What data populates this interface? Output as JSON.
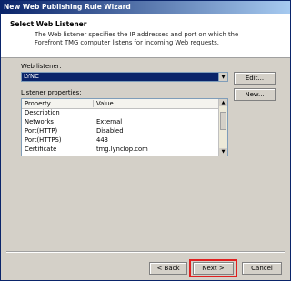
{
  "window": {
    "title": "New Web Publishing Rule Wizard"
  },
  "header": {
    "title": "Select Web Listener",
    "description": "The Web listener specifies the IP addresses and port on which the Forefront TMG computer listens for incoming Web requests."
  },
  "listener": {
    "label": "Web listener:",
    "selected": "LYNC",
    "edit_label": "Edit...",
    "new_label": "New..."
  },
  "properties": {
    "label": "Listener properties:",
    "columns": [
      "Property",
      "Value"
    ],
    "rows": [
      {
        "property": "Description",
        "value": ""
      },
      {
        "property": "Networks",
        "value": "External"
      },
      {
        "property": "Port(HTTP)",
        "value": "Disabled"
      },
      {
        "property": "Port(HTTPS)",
        "value": "443"
      },
      {
        "property": "Certificate",
        "value": "tmg.lynclop.com"
      }
    ]
  },
  "footer": {
    "back_label": "< Back",
    "next_label": "Next >",
    "cancel_label": "Cancel"
  },
  "colors": {
    "highlight": "#e02020",
    "selection": "#0a246a"
  }
}
